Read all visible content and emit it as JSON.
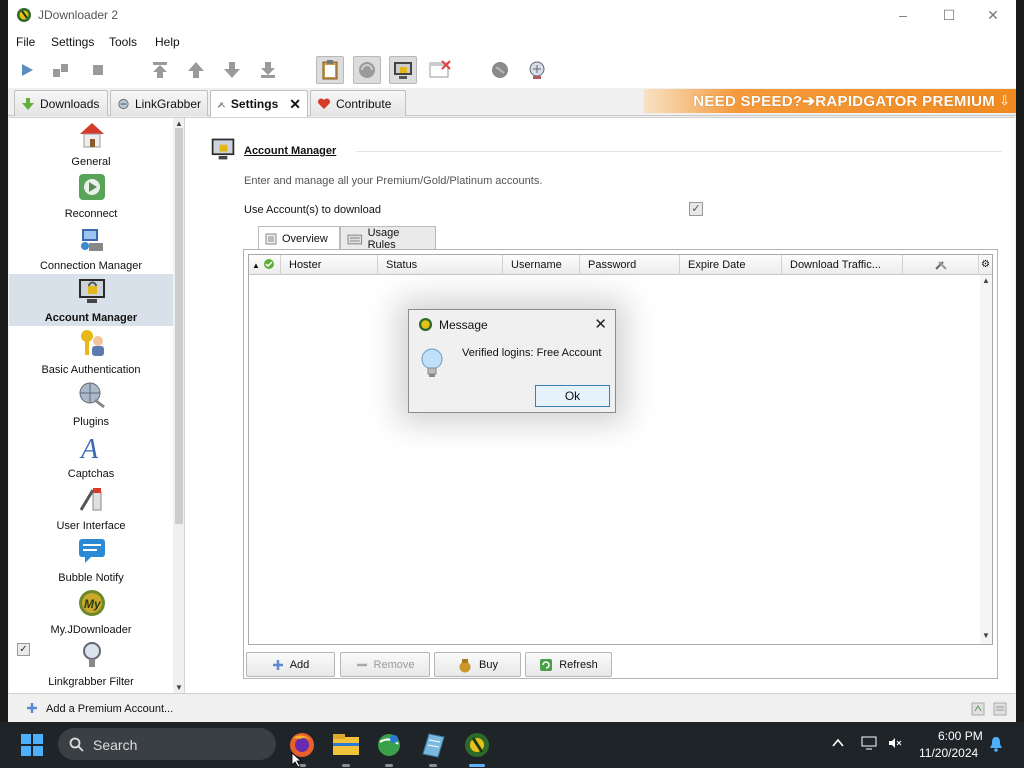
{
  "window": {
    "title": "JDownloader 2",
    "minimize": "–",
    "maximize": "☐",
    "close": "✕"
  },
  "menu": [
    "File",
    "Settings",
    "Tools",
    "Help"
  ],
  "toolbar_icons": [
    "play-icon",
    "pause-icon",
    "stop-icon",
    "move-top-icon",
    "move-up-icon",
    "move-down-icon",
    "move-bottom-icon",
    "clipboard-icon",
    "reconnect-icon",
    "premium-icon",
    "cleanup-icon",
    "refresh-icon",
    "update-icon"
  ],
  "tabs": [
    {
      "label": "Downloads"
    },
    {
      "label": "LinkGrabber"
    },
    {
      "label": "Settings",
      "close": "✕"
    },
    {
      "label": "Contribute"
    }
  ],
  "banner": {
    "text": "NEED SPEED?➔RAPIDGATOR PREMIUM",
    "arrow": "⇩"
  },
  "sidebar": {
    "items": [
      {
        "label": "General"
      },
      {
        "label": "Reconnect"
      },
      {
        "label": "Connection Manager"
      },
      {
        "label": "Account Manager"
      },
      {
        "label": "Basic Authentication"
      },
      {
        "label": "Plugins"
      },
      {
        "label": "Captchas"
      },
      {
        "label": "User Interface"
      },
      {
        "label": "Bubble Notify"
      },
      {
        "label": "My.JDownloader"
      },
      {
        "label": "Linkgrabber Filter"
      }
    ],
    "selected": "Account Manager"
  },
  "panel": {
    "title": "Account Manager",
    "description": "Enter and manage all your Premium/Gold/Platinum accounts.",
    "use_accounts_label": "Use Account(s) to download",
    "use_accounts_checked": "✓",
    "subtabs": [
      {
        "label": "Overview"
      },
      {
        "label": "Usage Rules"
      }
    ],
    "columns": [
      "Hoster",
      "Status",
      "Username",
      "Password",
      "Expire Date",
      "Download Traffic..."
    ],
    "buttons": [
      {
        "label": "Add"
      },
      {
        "label": "Remove"
      },
      {
        "label": "Buy"
      },
      {
        "label": "Refresh"
      }
    ]
  },
  "statusbar": {
    "text": "Add a Premium Account..."
  },
  "dialog": {
    "title": "Message",
    "message": "Verified logins: Free Account",
    "ok": "Ok",
    "close": "✕"
  },
  "taskbar": {
    "search_placeholder": "Search",
    "time": "6:00 PM",
    "date": "11/20/2024"
  },
  "colors": {
    "accent": "#5fb0ff",
    "banner": "#f08a20",
    "sidebar_selected": "#d8e1ea"
  }
}
